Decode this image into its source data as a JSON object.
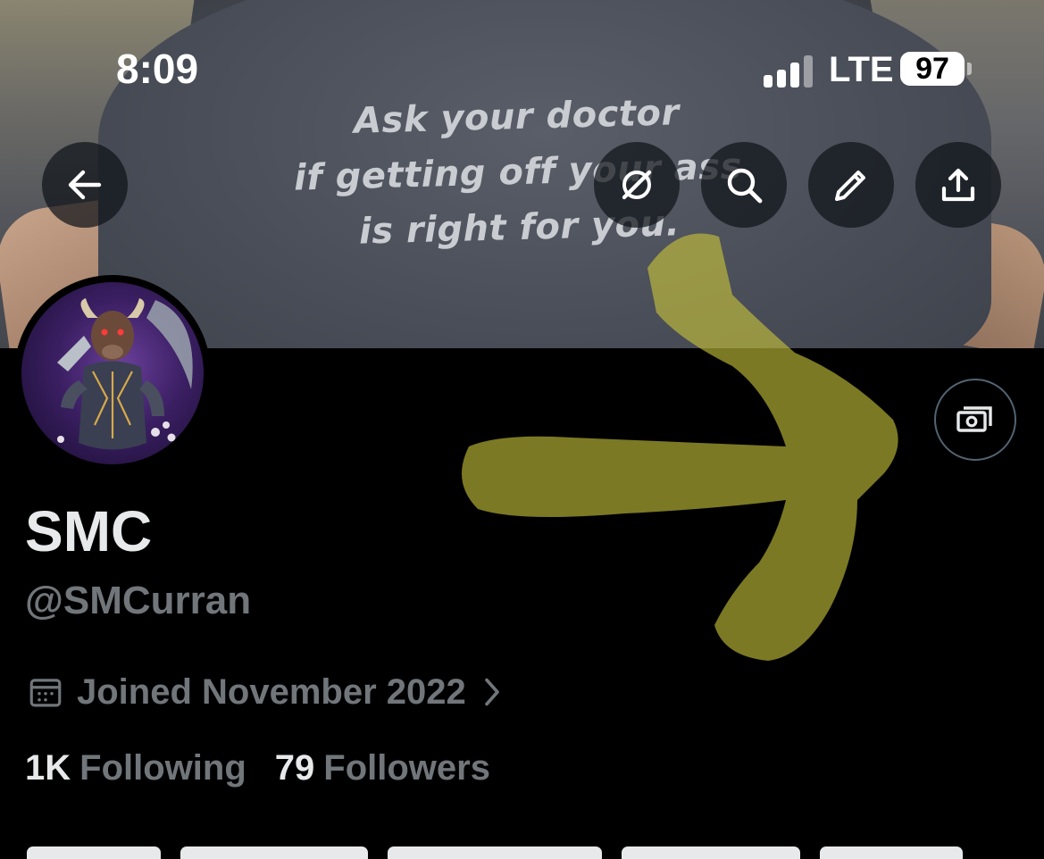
{
  "status_bar": {
    "time": "8:09",
    "network": "LTE",
    "battery": "97",
    "signal_bars_filled": 3,
    "signal_bars_total": 4
  },
  "banner": {
    "shirt_text_line1": "Ask your doctor",
    "shirt_text_line2": "if getting off your ass",
    "shirt_text_line3": "is right for you."
  },
  "header_buttons": {
    "back": "arrow-left-icon",
    "grok": "grok-slash-icon",
    "search": "search-icon",
    "edit": "pencil-icon",
    "share": "share-upload-icon"
  },
  "profile": {
    "display_name": "SMC",
    "handle": "@SMCurran",
    "joined": "Joined November 2022",
    "following_count": "1K",
    "following_label": "Following",
    "followers_count": "79",
    "followers_label": "Followers",
    "monetization_icon": "money-icon"
  },
  "colors": {
    "background": "#000000",
    "primary_text": "#e7e9ea",
    "secondary_text": "#71767b",
    "highlighter": "#c8c43a",
    "button_border": "#536471"
  }
}
